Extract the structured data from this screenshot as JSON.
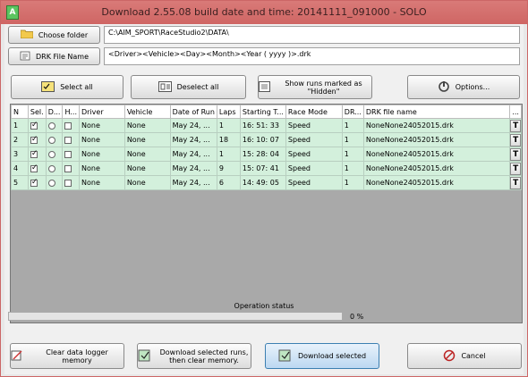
{
  "window": {
    "title": "Download 2.55.08 build date and time:  20141111_091000 - SOLO"
  },
  "folder": {
    "choose_label": "Choose folder",
    "path": "C:\\AIM_SPORT\\RaceStudio2\\DATA\\"
  },
  "drk": {
    "label": "DRK File Name",
    "pattern": "<Driver><Vehicle><Day><Month><Year ( yyyy )>.drk"
  },
  "toolbar": {
    "select_all": "Select all",
    "deselect_all": "Deselect all",
    "show_hidden": "Show runs marked as \"Hidden\"",
    "options": "Options..."
  },
  "table": {
    "headers": [
      "N",
      "Sel.",
      "D...",
      "H...",
      "Driver",
      "Vehicle",
      "Date of Run",
      "Laps",
      "Starting T...",
      "Race Mode",
      "DR...",
      "DRK file name",
      "..."
    ],
    "rows": [
      {
        "n": "1",
        "sel": true,
        "driver": "None",
        "vehicle": "None",
        "date": "May  24,  ...",
        "laps": "1",
        "start": "16: 51: 33",
        "mode": "Speed",
        "dr": "1",
        "file": "NoneNone24052015.drk",
        "t": "T"
      },
      {
        "n": "2",
        "sel": true,
        "driver": "None",
        "vehicle": "None",
        "date": "May  24,  ...",
        "laps": "18",
        "start": "16: 10: 07",
        "mode": "Speed",
        "dr": "1",
        "file": "NoneNone24052015.drk",
        "t": "T"
      },
      {
        "n": "3",
        "sel": true,
        "driver": "None",
        "vehicle": "None",
        "date": "May  24,  ...",
        "laps": "1",
        "start": "15: 28: 04",
        "mode": "Speed",
        "dr": "1",
        "file": "NoneNone24052015.drk",
        "t": "T"
      },
      {
        "n": "4",
        "sel": true,
        "driver": "None",
        "vehicle": "None",
        "date": "May  24,  ...",
        "laps": "9",
        "start": "15: 07: 41",
        "mode": "Speed",
        "dr": "1",
        "file": "NoneNone24052015.drk",
        "t": "T"
      },
      {
        "n": "5",
        "sel": true,
        "driver": "None",
        "vehicle": "None",
        "date": "May  24,  ...",
        "laps": "6",
        "start": "14: 49: 05",
        "mode": "Speed",
        "dr": "1",
        "file": "NoneNone24052015.drk",
        "t": "T"
      }
    ]
  },
  "status": {
    "label": "Operation status",
    "progress_fraction": 0.0,
    "percent_text": "0 %"
  },
  "footer": {
    "clear_memory": "Clear data logger memory",
    "download_then_clear": "Download selected runs, then clear memory.",
    "download_selected": "Download selected",
    "cancel": "Cancel"
  },
  "icons": {
    "app": "app-icon",
    "folder": "folder-icon",
    "drk": "document-icon"
  }
}
